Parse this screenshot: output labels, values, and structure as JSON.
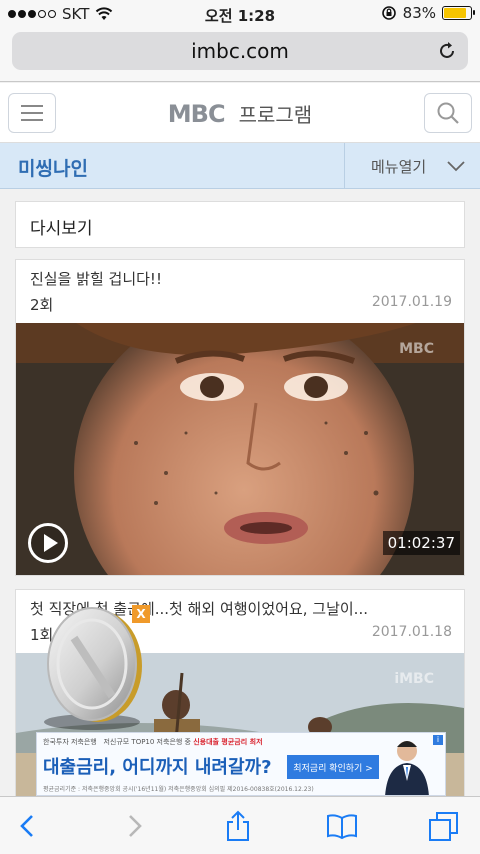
{
  "status_bar": {
    "carrier": "SKT",
    "time": "오전 1:28",
    "battery_percent": "83%",
    "battery_level": 0.83,
    "signal_bars": 3
  },
  "browser": {
    "url": "imbc.com"
  },
  "header": {
    "logo": "MBC",
    "title": "프로그램"
  },
  "subnav": {
    "show_name": "미씽나인",
    "menu_label": "메뉴열기"
  },
  "section": {
    "title": "다시보기"
  },
  "episodes": [
    {
      "title": "진실을 밝힐 겁니다!!",
      "episode": "2회",
      "date": "2017.01.19",
      "duration": "01:02:37",
      "watermark": "MBC"
    },
    {
      "title": "첫 직장에 첫 출근에...첫 해외 여행이었어요, 그날이...",
      "episode": "1회",
      "date": "2017.01.18",
      "watermark": "iMBC"
    }
  ],
  "ad": {
    "small": "한국투자 저축은행",
    "small2": "저신규모 TOP10 저축은행 중",
    "small_red": "신용대출 평균금리 최저",
    "main": "대출금리, 어디까지 내려갈까?",
    "button": "최저금리 확인하기 >",
    "footer": "평균금리기준 : 저축은행중앙회 공시('16년11월)   저축은행중앙회 심의필 제2016-00838호(2016.12.23)",
    "close": "X"
  },
  "colors": {
    "accent": "#2f6db3",
    "subnav_bg": "#d8e8f7",
    "ad_blue": "#1b5fb8"
  }
}
